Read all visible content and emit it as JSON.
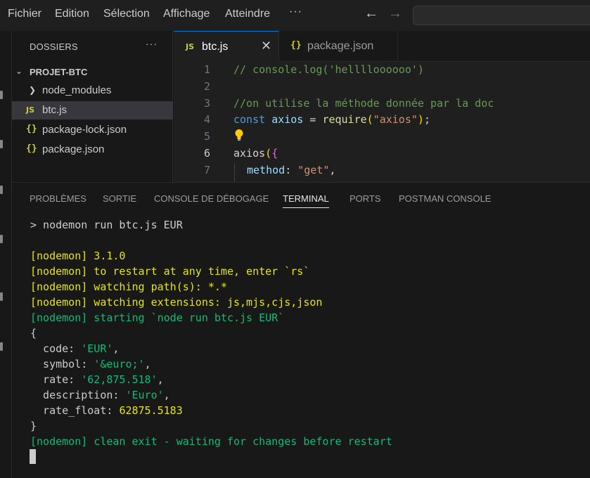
{
  "menu": [
    "Fichier",
    "Edition",
    "Sélection",
    "Affichage",
    "Atteindre"
  ],
  "menu_more": "···",
  "nav": {
    "back": "←",
    "forward": "→"
  },
  "explorer": {
    "title": "DOSSIERS",
    "more": "···",
    "root": "PROJET-BTC",
    "items": [
      {
        "label": "node_modules",
        "kind": "folder"
      },
      {
        "label": "btc.js",
        "kind": "js",
        "icon": "JS"
      },
      {
        "label": "package-lock.json",
        "kind": "json",
        "icon": "{}"
      },
      {
        "label": "package.json",
        "kind": "json",
        "icon": "{}"
      }
    ]
  },
  "tabs": [
    {
      "label": "btc.js",
      "icon": "JS",
      "close": "✕"
    },
    {
      "label": "package.json",
      "icon": "{}"
    }
  ],
  "editor": {
    "line_numbers": [
      "1",
      "2",
      "3",
      "4",
      "5",
      "6",
      "7"
    ],
    "current_line": "6",
    "l1": "// console.log('helllloooooo')",
    "l3": "//on utilise la méthode donnée par la doc",
    "l4": {
      "kw": "const",
      "var": "axios",
      "eq": " = ",
      "fn": "require",
      "open": "(",
      "str": "\"axios\"",
      "close": ");"
    },
    "l6": {
      "name": "axios",
      "open_paren": "(",
      "open_brace": "{"
    },
    "l7": {
      "key": "method",
      "colon": ": ",
      "str": "\"get\"",
      "comma": ","
    }
  },
  "panel": {
    "tabs": [
      "PROBLÈMES",
      "SORTIE",
      "CONSOLE DE DÉBOGAGE",
      "TERMINAL",
      "PORTS",
      "POSTMAN CONSOLE"
    ],
    "active_tab": "TERMINAL"
  },
  "terminal": {
    "cmd": "> nodemon run btc.js EUR",
    "y1": "[nodemon] 3.1.0",
    "y2": "[nodemon] to restart at any time, enter `rs`",
    "y3": "[nodemon] watching path(s): *.*",
    "y4": "[nodemon] watching extensions: js,mjs,cjs,json",
    "g1": "[nodemon] starting `node run btc.js EUR`",
    "open": "{",
    "code_key": "  code: ",
    "code_val": "'EUR'",
    "code_end": ",",
    "symbol_key": "  symbol: ",
    "symbol_val": "'&euro;'",
    "symbol_end": ",",
    "rate_key": "  rate: ",
    "rate_val": "'62,875.518'",
    "rate_end": ",",
    "desc_key": "  description: ",
    "desc_val": "'Euro'",
    "desc_end": ",",
    "rf_key": "  rate_float: ",
    "rf_val": "62875.5183",
    "close": "}",
    "g2": "[nodemon] clean exit - waiting for changes before restart"
  },
  "colors": {
    "accent": "#0078d4",
    "terminal_yellow": "#e5e510",
    "terminal_green": "#0dbc79",
    "js_icon": "#cbcb41"
  }
}
